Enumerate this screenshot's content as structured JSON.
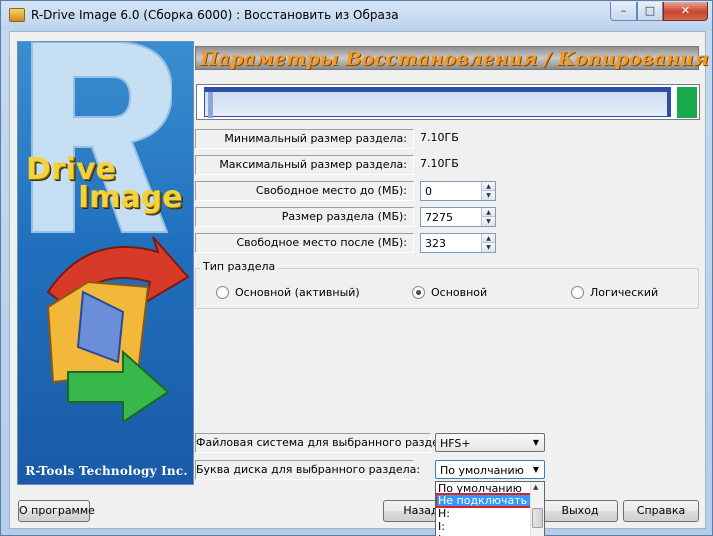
{
  "window": {
    "title": "R-Drive Image 6.0 (Сборка 6000) : Восстановить из Образа",
    "min_glyph": "–",
    "max_glyph": "□",
    "close_glyph": "✕"
  },
  "banner": {
    "drive": "Drive",
    "image": "Image",
    "footer": "R-Tools Technology Inc."
  },
  "header": {
    "title": "Параметры Восстановления / Копирования"
  },
  "fields": {
    "min_size_label": "Минимальный размер раздела:",
    "min_size_value": "7.10ГБ",
    "max_size_label": "Максимальный размер раздела:",
    "max_size_value": "7.10ГБ",
    "free_before_label": "Свободное место до (МБ):",
    "free_before_value": "0",
    "partition_size_label": "Размер раздела (МБ):",
    "partition_size_value": "7275",
    "free_after_label": "Свободное место после (МБ):",
    "free_after_value": "323"
  },
  "partition_type": {
    "title": "Тип раздела",
    "options": [
      "Основной (активный)",
      "Основной",
      "Логический"
    ],
    "selected_index": 1
  },
  "filesystem": {
    "label": "Файловая система для выбранного раздела:",
    "value": "HFS+"
  },
  "drive_letter": {
    "label": "Буква диска для выбранного раздела:",
    "value": "По умолчанию",
    "options": [
      "По умолчанию",
      "Не подключать",
      "H:",
      "I:",
      "J:"
    ],
    "highlighted_index": 1
  },
  "buttons": {
    "about": "О программе",
    "back": "Назад",
    "exit": "Выход",
    "help": "Справка"
  },
  "colors": {
    "header_text": "#f39a2a",
    "partition_fill": "#2d4fa8",
    "free_space": "#19a84a",
    "highlight": "#3399ff",
    "highlight_outline": "#e02020"
  }
}
